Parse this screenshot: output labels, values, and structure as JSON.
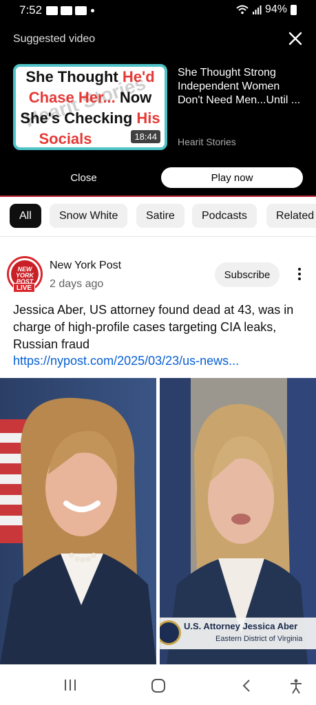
{
  "status_bar": {
    "time": "7:52",
    "battery": "94%"
  },
  "suggested": {
    "header": "Suggested video",
    "thumbnail": {
      "line1_a": "She Thought ",
      "line1_b": "He'd",
      "line2_a": "Chase Her... ",
      "line2_b": "Now",
      "line3_a": "She's Checking ",
      "line3_b": "His",
      "line4": "Socials",
      "watermark": "Hearit Stories",
      "duration": "18:44"
    },
    "title": "She Thought Strong Independent Women Don't Need Men...Until ...",
    "channel": "Hearit Stories",
    "close_label": "Close",
    "play_label": "Play now"
  },
  "chips": [
    {
      "label": "All",
      "active": true
    },
    {
      "label": "Snow White"
    },
    {
      "label": "Satire"
    },
    {
      "label": "Podcasts"
    },
    {
      "label": "Related"
    }
  ],
  "post": {
    "avatar_text": "NEW YORK POST",
    "live_badge": "LIVE",
    "channel": "New York Post",
    "time": "2 days ago",
    "subscribe_label": "Subscribe",
    "text": "Jessica Aber, US attorney found dead at 43, was in charge of high-profile cases targeting CIA leaks, Russian fraud",
    "link": "https://nypost.com/2025/03/23/us-news...",
    "image_caption": {
      "line1": "U.S. Attorney Jessica Aber",
      "line2": "Eastern District of Virginia"
    }
  },
  "colors": {
    "accent_red": "#d8262b",
    "link_blue": "#065fd4",
    "thumb_border": "#4fc3c8"
  }
}
